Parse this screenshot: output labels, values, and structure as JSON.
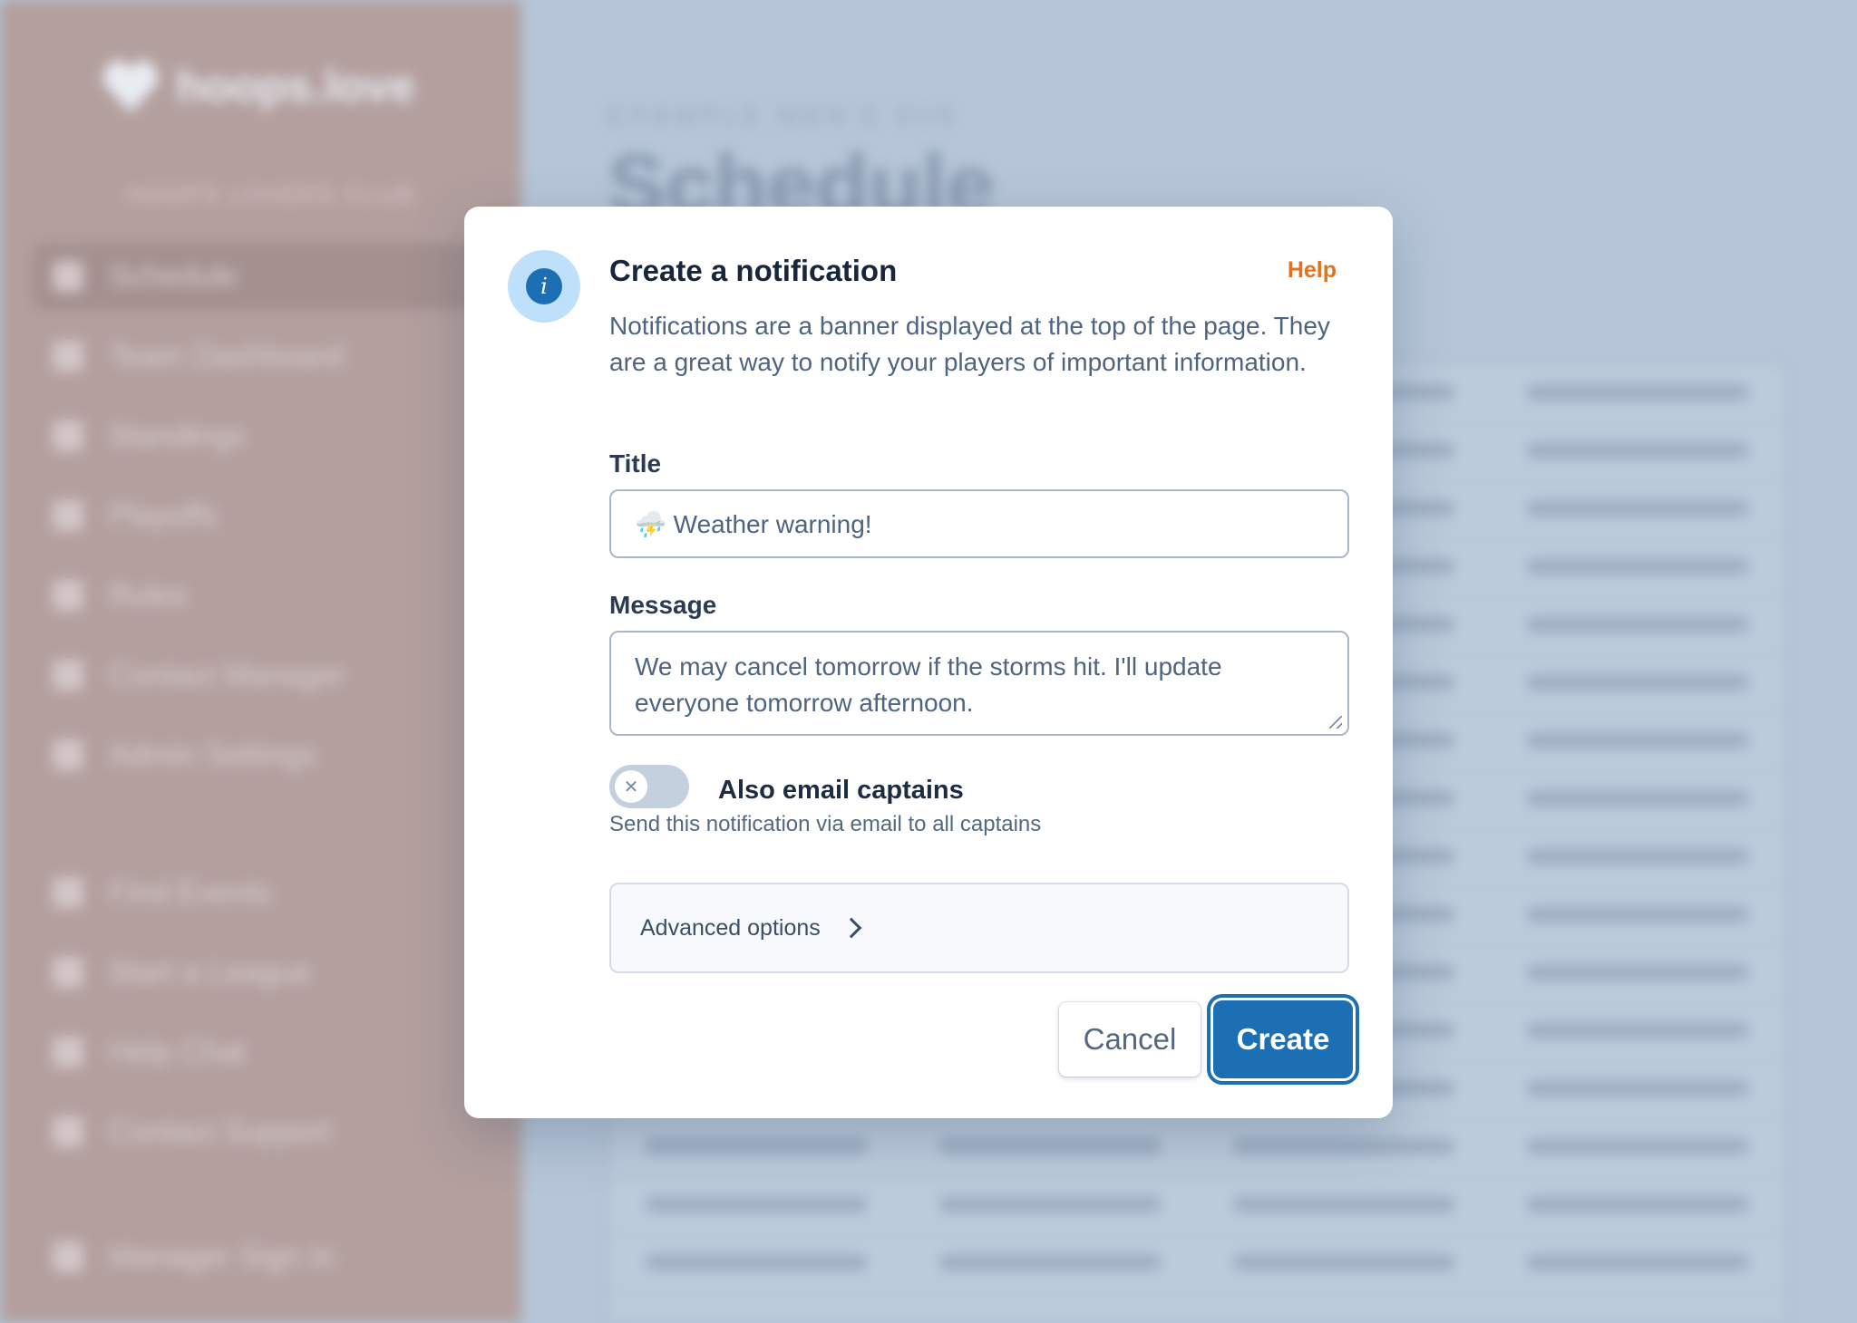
{
  "background": {
    "sidebar": {
      "logo_text": "hoops.love",
      "league_name": "HOOPS LOVERS CLUB",
      "nav_items": [
        "Schedule",
        "Team Dashboard",
        "Standings",
        "Playoffs",
        "Rules",
        "Contact Manager",
        "Admin Settings"
      ],
      "lower_items": [
        "Find Events",
        "Start a League",
        "Help Chat",
        "Contact Support"
      ],
      "footer_item": "Manager Sign In"
    },
    "main": {
      "breadcrumb": "EXAMPLE MEN'S 5V5",
      "page_title": "Schedule"
    }
  },
  "modal": {
    "title": "Create a notification",
    "help_label": "Help",
    "description": "Notifications are a banner displayed at the top of the page. They are a great way to notify your players of important information.",
    "title_field": {
      "label": "Title",
      "value": "⛈️ Weather warning!"
    },
    "message_field": {
      "label": "Message",
      "value": "We may cancel tomorrow if the storms hit. I'll update everyone tomorrow afternoon."
    },
    "email_toggle": {
      "label": "Also email captains",
      "hint": "Send this notification via email to all captains",
      "enabled": false,
      "knob_glyph": "✕"
    },
    "advanced_label": "Advanced options",
    "cancel_label": "Cancel",
    "create_label": "Create",
    "icon": "info-icon"
  },
  "colors": {
    "primary": "#1d6fb4",
    "help_link": "#e4711b",
    "overlay_sidebar": "#b39f9e",
    "overlay_main": "#b6c6d8"
  }
}
